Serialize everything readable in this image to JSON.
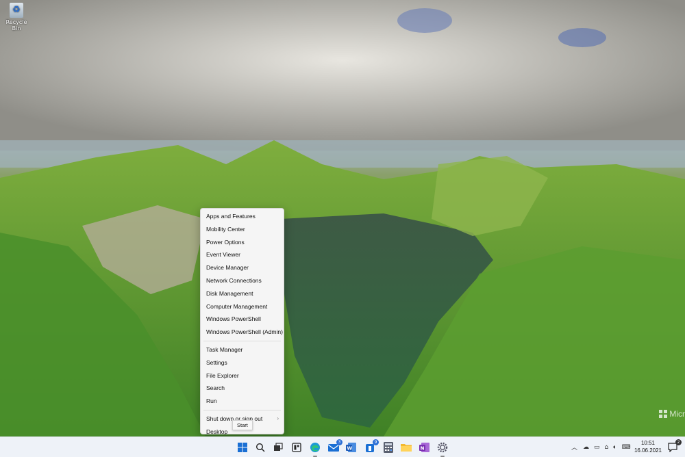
{
  "desktop": {
    "recycle_bin_label": "Recycle Bin",
    "watermark_text": "Micr"
  },
  "context_menu": {
    "groups": [
      [
        "Apps and Features",
        "Mobility Center",
        "Power Options",
        "Event Viewer",
        "Device Manager",
        "Network Connections",
        "Disk Management",
        "Computer Management",
        "Windows PowerShell",
        "Windows PowerShell (Admin)"
      ],
      [
        "Task Manager",
        "Settings",
        "File Explorer",
        "Search",
        "Run"
      ],
      [
        "Shut down or sign out",
        "Desktop"
      ]
    ],
    "submenu_chevron": "›"
  },
  "tooltip": {
    "text": "Start"
  },
  "taskbar": {
    "icons": [
      "windows-start-icon",
      "search-icon",
      "task-view-icon",
      "widgets-icon",
      "edge-icon",
      "mail-icon",
      "word-icon",
      "teams-icon",
      "calculator-icon",
      "file-explorer-icon",
      "onenote-icon",
      "settings-icon"
    ],
    "mail_badge": "3",
    "teams_badge": "9",
    "accent": "#2b6fd6"
  },
  "tray": {
    "time": "10:51",
    "date": "16.06.2021",
    "notification_count": "2"
  }
}
